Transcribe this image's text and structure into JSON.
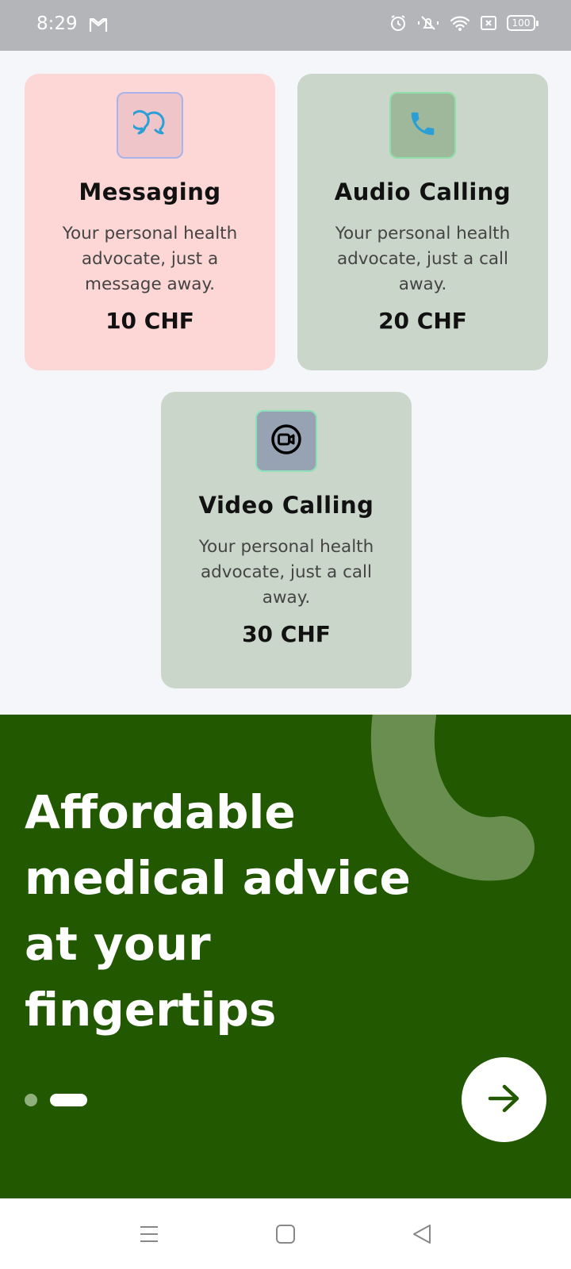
{
  "status_bar": {
    "time": "8:29",
    "battery": "100",
    "icons": [
      "gmail-icon",
      "alarm-icon",
      "mute-icon",
      "wifi-icon",
      "sim-off-icon",
      "battery-icon"
    ]
  },
  "services": [
    {
      "title": "Messaging",
      "description": "Your personal health advocate, just a message away.",
      "price": "10 CHF",
      "icon": "chat-bubbles-icon"
    },
    {
      "title": "Audio Calling",
      "description": "Your personal health advocate, just a call away.",
      "price": "20 CHF",
      "icon": "phone-icon"
    },
    {
      "title": "Video Calling",
      "description": "Your personal health advocate, just a call away.",
      "price": "30 CHF",
      "icon": "video-camera-icon"
    }
  ],
  "hero": {
    "title": "Affordable medical advice at your fingertips",
    "page_indicator": {
      "total": 2,
      "active": 2
    },
    "next_icon": "arrow-right-icon"
  },
  "nav_bar": {
    "icons": [
      "menu-icon",
      "home-icon",
      "back-icon"
    ]
  },
  "colors": {
    "hero_background": "#225900",
    "icon_accent": "#2a9fd6"
  }
}
